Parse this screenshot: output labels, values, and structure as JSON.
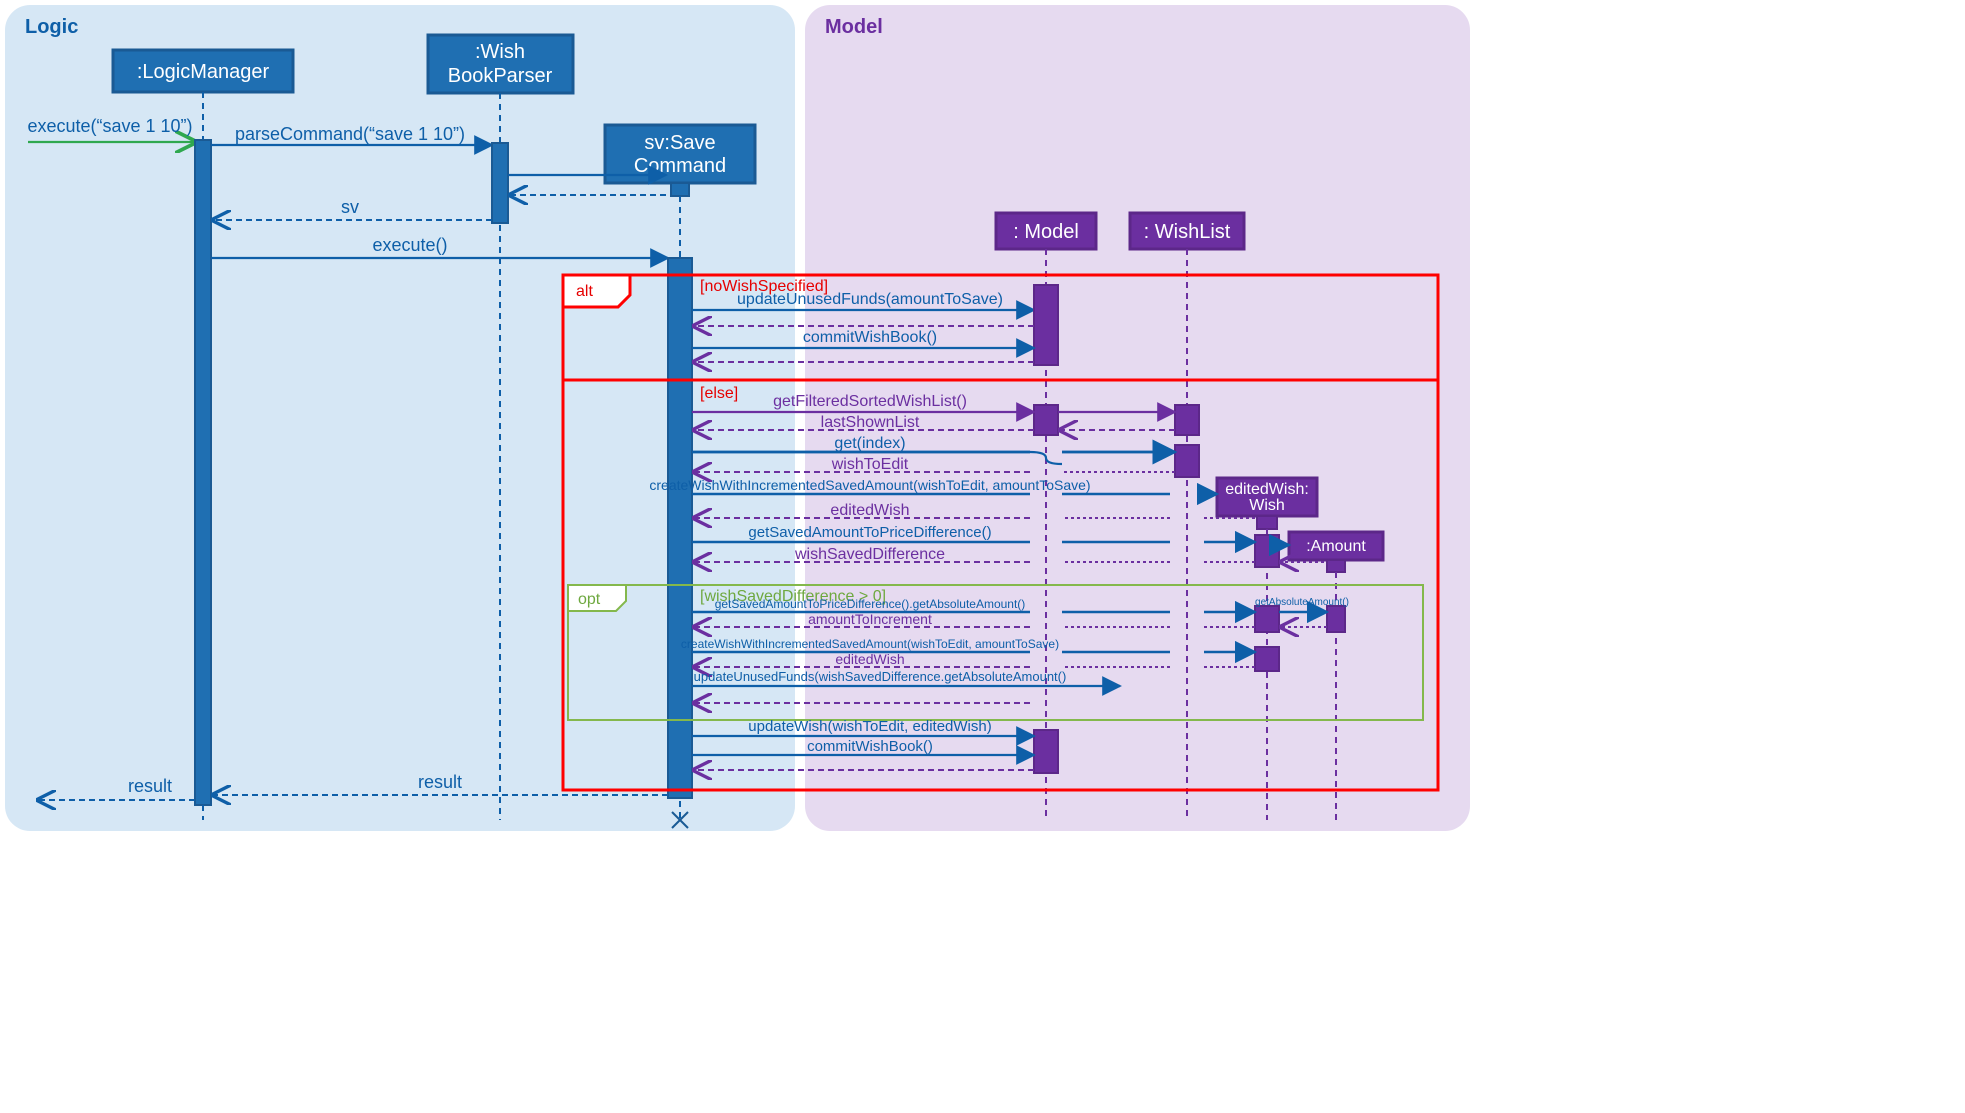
{
  "frames": {
    "logic": "Logic",
    "model": "Model",
    "alt": "alt",
    "opt": "opt",
    "alt_guard1": "[noWishSpecified]",
    "alt_guard2": "[else]",
    "opt_guard": "[wishSavedDifference > 0]"
  },
  "lifelines": {
    "logicManager": ":LogicManager",
    "wishBookParser_l1": ":Wish",
    "wishBookParser_l2": "BookParser",
    "saveCommand_l1": "sv:Save",
    "saveCommand_l2": "Command",
    "model": ": Model",
    "wishList": ": WishList",
    "editedWish_l1": "editedWish:",
    "editedWish_l2": "Wish",
    "amount": ":Amount"
  },
  "messages": {
    "execute_in": "execute(“save 1 10”)",
    "parseCommand": "parseCommand(“save 1 10”)",
    "sv_return": "sv",
    "execute_call": "execute()",
    "updateUnusedFunds1": "updateUnusedFunds(amountToSave)",
    "commitWishBook1": "commitWishBook()",
    "getFilteredSortedWishList": "getFilteredSortedWishList()",
    "lastShownList": "lastShownList",
    "get_index": "get(index)",
    "wishToEdit": "wishToEdit",
    "createWish1": "createWishWithIncrementedSavedAmount(wishToEdit, amountToSave)",
    "editedWish_ret1": "editedWish",
    "getSavedAmountDiff": "getSavedAmountToPriceDifference()",
    "wishSavedDifference": "wishSavedDifference",
    "getSavedAmountDiffAbs": "getSavedAmountToPriceDifference().getAbsoluteAmount()",
    "getAbsoluteAmount": "getAbsoluteAmount()",
    "amountToIncrement": "amountToIncrement",
    "createWish2": "createWishWithIncrementedSavedAmount(wishToEdit, amountToSave)",
    "editedWish_ret2": "editedWish",
    "updateUnusedFunds2": "updateUnusedFunds(wishSavedDifference.getAbsoluteAmount()",
    "updateWish": "updateWish(wishToEdit, editedWish)",
    "commitWishBook2": "commitWishBook()",
    "result_inner": "result",
    "result_out": "result"
  },
  "colors": {
    "logic_bg": "#d6e7f5",
    "model_bg": "#e6daf0",
    "blue_box": "#1f6fb2",
    "blue_stroke": "#1a5a94",
    "purple_box": "#6b2fa0",
    "purple_stroke": "#5c2789",
    "alt_red": "#ff0000",
    "opt_green": "#84b84c",
    "arrow_green": "#2fa84f"
  }
}
